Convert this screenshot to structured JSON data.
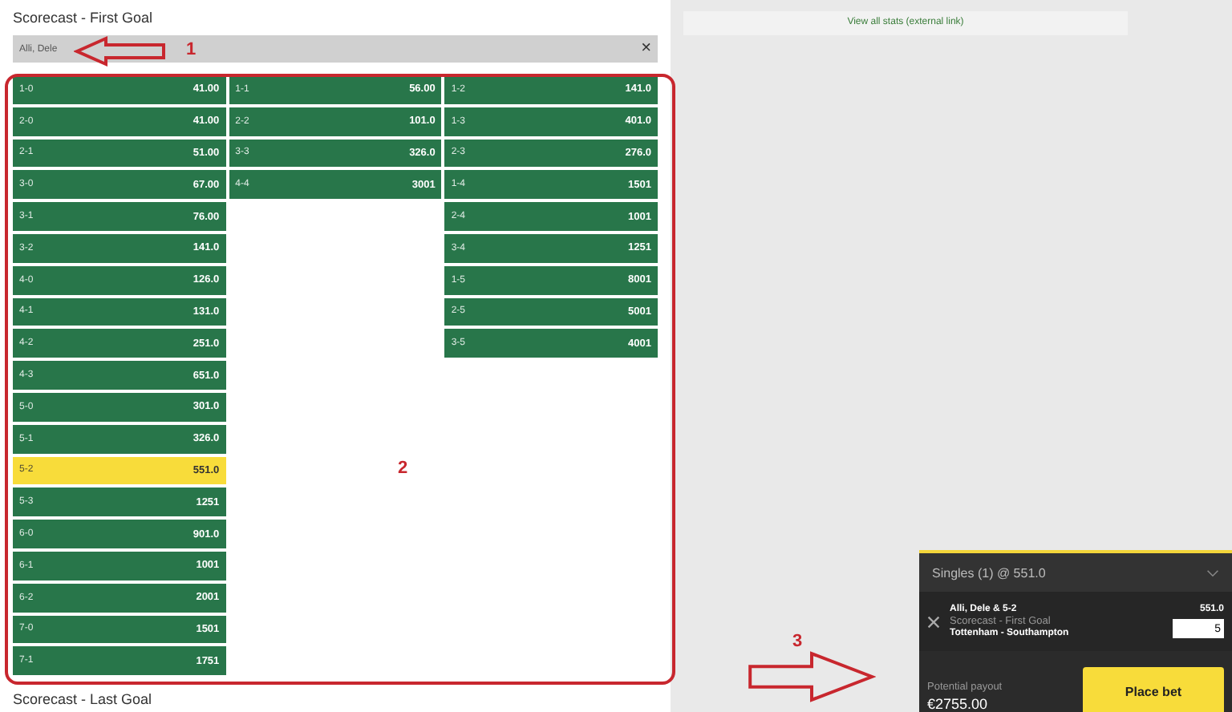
{
  "market": {
    "title": "Scorecast - First Goal",
    "selection": "Alli, Dele",
    "close": "×",
    "columns": [
      [
        {
          "score": "1-0",
          "odds": "41.00",
          "selected": false
        },
        {
          "score": "2-0",
          "odds": "41.00",
          "selected": false
        },
        {
          "score": "2-1",
          "odds": "51.00",
          "selected": false
        },
        {
          "score": "3-0",
          "odds": "67.00",
          "selected": false
        },
        {
          "score": "3-1",
          "odds": "76.00",
          "selected": false
        },
        {
          "score": "3-2",
          "odds": "141.0",
          "selected": false
        },
        {
          "score": "4-0",
          "odds": "126.0",
          "selected": false
        },
        {
          "score": "4-1",
          "odds": "131.0",
          "selected": false
        },
        {
          "score": "4-2",
          "odds": "251.0",
          "selected": false
        },
        {
          "score": "4-3",
          "odds": "651.0",
          "selected": false
        },
        {
          "score": "5-0",
          "odds": "301.0",
          "selected": false
        },
        {
          "score": "5-1",
          "odds": "326.0",
          "selected": false
        },
        {
          "score": "5-2",
          "odds": "551.0",
          "selected": true
        },
        {
          "score": "5-3",
          "odds": "1251",
          "selected": false
        },
        {
          "score": "6-0",
          "odds": "901.0",
          "selected": false
        },
        {
          "score": "6-1",
          "odds": "1001",
          "selected": false
        },
        {
          "score": "6-2",
          "odds": "2001",
          "selected": false
        },
        {
          "score": "7-0",
          "odds": "1501",
          "selected": false
        },
        {
          "score": "7-1",
          "odds": "1751",
          "selected": false
        }
      ],
      [
        {
          "score": "1-1",
          "odds": "56.00",
          "selected": false
        },
        {
          "score": "2-2",
          "odds": "101.0",
          "selected": false
        },
        {
          "score": "3-3",
          "odds": "326.0",
          "selected": false
        },
        {
          "score": "4-4",
          "odds": "3001",
          "selected": false
        }
      ],
      [
        {
          "score": "1-2",
          "odds": "141.0",
          "selected": false
        },
        {
          "score": "1-3",
          "odds": "401.0",
          "selected": false
        },
        {
          "score": "2-3",
          "odds": "276.0",
          "selected": false
        },
        {
          "score": "1-4",
          "odds": "1501",
          "selected": false
        },
        {
          "score": "2-4",
          "odds": "1001",
          "selected": false
        },
        {
          "score": "3-4",
          "odds": "1251",
          "selected": false
        },
        {
          "score": "1-5",
          "odds": "8001",
          "selected": false
        },
        {
          "score": "2-5",
          "odds": "5001",
          "selected": false
        },
        {
          "score": "3-5",
          "odds": "4001",
          "selected": false
        }
      ]
    ]
  },
  "next_market": {
    "title": "Scorecast - Last Goal"
  },
  "stats_link": "View all stats (external link)",
  "annotations": [
    "1",
    "2",
    "3"
  ],
  "bet_slip": {
    "header": "Singles (1) @ 551.0",
    "selection": "Alli, Dele & 5-2",
    "market": "Scorecast - First Goal",
    "event": "Tottenham - Southampton",
    "odds": "551.0",
    "stake": "5",
    "payout_label": "Potential payout",
    "payout": "€2755.00",
    "place_bet": "Place bet"
  }
}
